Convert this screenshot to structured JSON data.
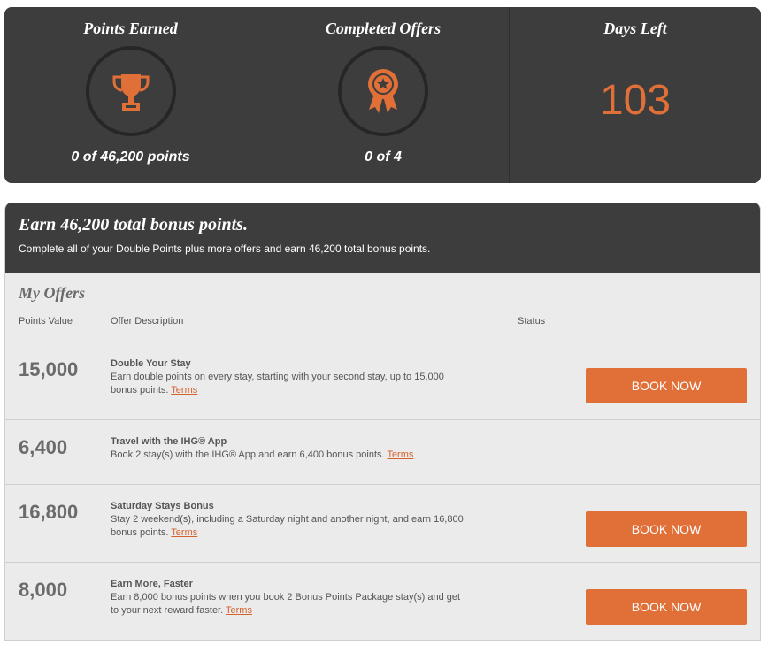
{
  "stats": {
    "points_earned": {
      "title": "Points Earned",
      "value": "0 of 46,200 points",
      "icon": "trophy-icon"
    },
    "completed_offers": {
      "title": "Completed Offers",
      "value": "0 of 4",
      "icon": "award-ribbon-icon"
    },
    "days_left": {
      "title": "Days Left",
      "value": "103"
    }
  },
  "offers_panel": {
    "heading": "Earn 46,200 total bonus points.",
    "description": "Complete all of your Double Points plus more offers and earn 46,200 total bonus points.",
    "section_title": "My Offers",
    "columns": {
      "points_value": "Points Value",
      "offer_description": "Offer Description",
      "status": "Status"
    },
    "offers": [
      {
        "points": "15,000",
        "title": "Double Your Stay",
        "text": "Earn double points on every stay, starting with your second stay, up to 15,000 bonus points.",
        "terms": "Terms",
        "button": "BOOK NOW"
      },
      {
        "points": "6,400",
        "title": "Travel with the IHG® App",
        "text": "Book 2 stay(s) with the IHG® App and earn 6,400 bonus points.",
        "terms": "Terms"
      },
      {
        "points": "16,800",
        "title": "Saturday Stays Bonus",
        "text": "Stay 2 weekend(s), including a Saturday night and another night, and earn 16,800 bonus points.",
        "terms": "Terms",
        "button": "BOOK NOW"
      },
      {
        "points": "8,000",
        "title": "Earn More, Faster",
        "text": "Earn 8,000 bonus points when you book 2 Bonus Points Package stay(s) and get to your next reward faster.",
        "terms": "Terms",
        "button": "BOOK NOW"
      }
    ]
  },
  "colors": {
    "accent": "#e07037",
    "panel_dark": "#3d3d3d",
    "panel_light": "#ebebeb"
  }
}
